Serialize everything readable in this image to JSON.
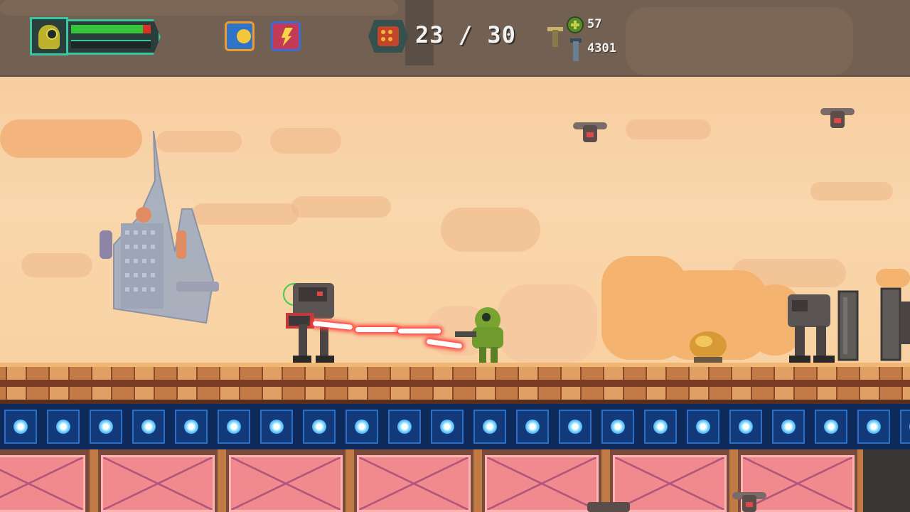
{
  "game": {
    "hud": {
      "player_portrait_icon": "yellow-soldier-portrait",
      "health_fraction": 0.9,
      "energy_fraction": 0.0,
      "weapon_slots": [
        {
          "name": "plasma-orb-weapon-icon"
        },
        {
          "name": "lightning-weapon-icon"
        }
      ],
      "ammo": {
        "icon": "shell-cluster-ammo-icon",
        "text": "23 / 30"
      },
      "resources": {
        "parts": {
          "icon": "gear-orb-icon",
          "value": "57"
        },
        "credits": {
          "icon": "bolt-icon",
          "value": "4301"
        }
      }
    },
    "colors": {
      "hud_bg": "#726152",
      "health": "#35c43a",
      "accent": "#39c7a1",
      "sky": "#f8d2a4"
    }
  }
}
